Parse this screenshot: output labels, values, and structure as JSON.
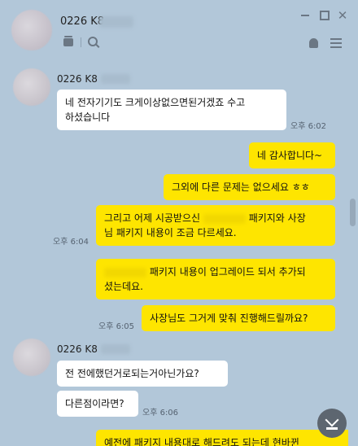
{
  "header": {
    "title": "0226 K8",
    "icons": [
      "drawer-icon",
      "search-icon",
      "bell-icon",
      "menu-icon"
    ],
    "window_controls": {
      "minimize": "—",
      "maximize": "□",
      "close": "✕"
    }
  },
  "messages": [
    {
      "type": "in",
      "sender": "0226 K8",
      "text_lines": [
        "네 전자기기도 크게이상없으면된거겠죠 수고",
        "하셨습니다"
      ],
      "time": "오후 6:02"
    },
    {
      "type": "out",
      "text": "네 감사합니다~"
    },
    {
      "type": "out",
      "text": "그외에 다른 문제는 없으세요 ㅎㅎ"
    },
    {
      "type": "out",
      "line1_pre": "그리고 어제 시공받으신",
      "line1_post": "패키지와 사장",
      "line2": "님 패키지 내용이 조금 다르세요.",
      "time": "오후 6:04"
    },
    {
      "type": "out",
      "line1_post": "패키지 내용이 업그레이드 되서 추가되",
      "line2": "셨는데요."
    },
    {
      "type": "out",
      "text": "사장님도 그거게 맞춰 진행해드릴까요?",
      "time": "오후 6:05"
    },
    {
      "type": "in",
      "sender": "0226 K8",
      "text": "전 전에했던거로되는거아닌가요?"
    },
    {
      "type": "in",
      "text": "다른점이라면?",
      "time": "오후 6:06"
    },
    {
      "type": "out",
      "text": "예전에 패키지 내용대로 해드려도 되는데 현바뀐"
    }
  ],
  "accent": {
    "background": "#b2c7d9",
    "bubble_out": "#fee500",
    "bubble_in": "#ffffff"
  }
}
